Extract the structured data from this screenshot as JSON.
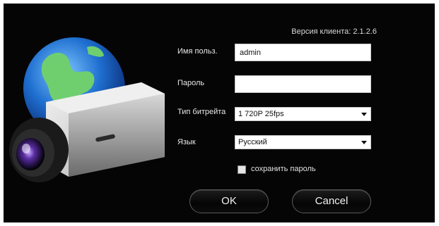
{
  "client_version": "Версия клиента: 2.1.2.6",
  "form": {
    "username_label": "Имя польз.",
    "username_value": "admin",
    "password_label": "Пароль",
    "password_value": "",
    "bitrate_label": "Тип битрейта",
    "bitrate_value": "1 720P 25fps",
    "language_label": "Язык",
    "language_value": "Русский",
    "save_password_label": "сохранить пароль",
    "save_password_checked": false
  },
  "buttons": {
    "ok": "OK",
    "cancel": "Cancel"
  },
  "illustration": {
    "icon": "globe-camera-icon"
  }
}
